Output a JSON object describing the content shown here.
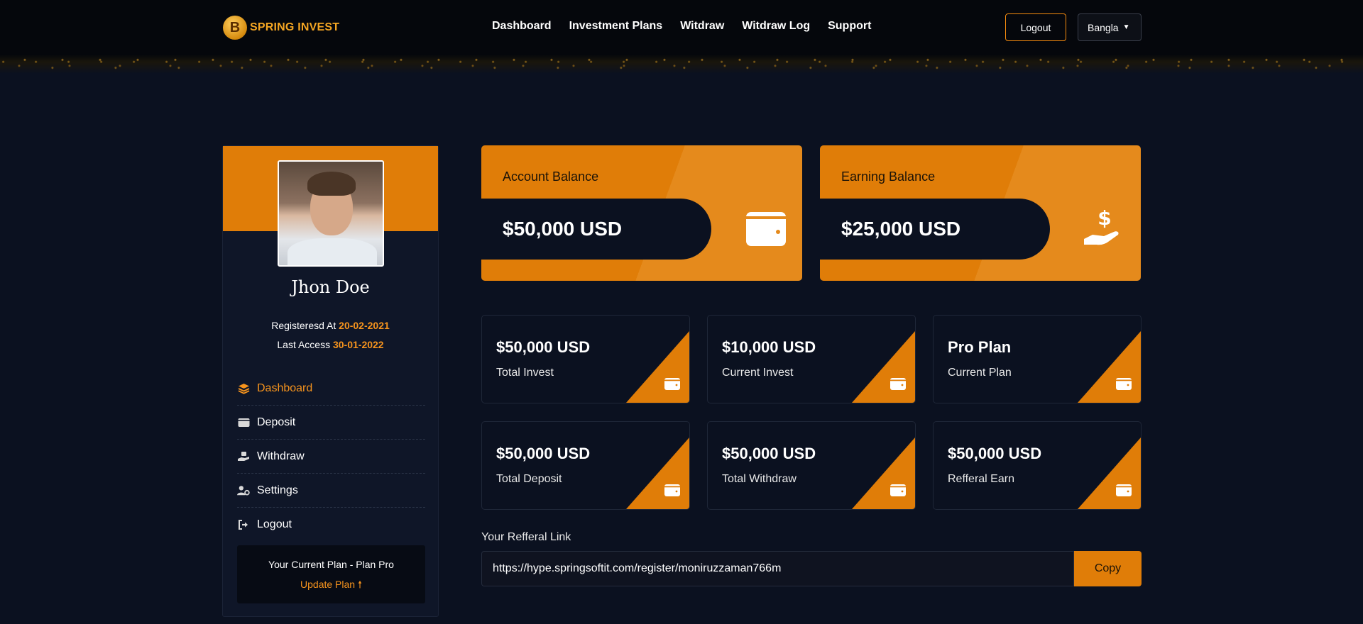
{
  "brand": {
    "name": "SPRING INVEST",
    "coin_glyph": "B"
  },
  "nav": [
    "Dashboard",
    "Investment Plans",
    "Witdraw",
    "Witdraw Log",
    "Support"
  ],
  "header": {
    "logout_label": "Logout",
    "language": "Bangla"
  },
  "profile": {
    "name": "Jhon Doe",
    "registered_label": "Registeresd At",
    "registered_date": "20-02-2021",
    "last_access_label": "Last Access",
    "last_access_date": "30-01-2022"
  },
  "menu": [
    {
      "label": "Dashboard",
      "icon": "layers-icon",
      "active": true
    },
    {
      "label": "Deposit",
      "icon": "wallet-icon",
      "active": false
    },
    {
      "label": "Withdraw",
      "icon": "hand-money-icon",
      "active": false
    },
    {
      "label": "Settings",
      "icon": "user-gear-icon",
      "active": false
    },
    {
      "label": "Logout",
      "icon": "sign-out-icon",
      "active": false
    }
  ],
  "plan": {
    "current_text": "Your Current Plan - Plan Pro",
    "update_label": "Update Plan",
    "update_icon": "arrow-up-icon"
  },
  "balances": [
    {
      "label": "Account Balance",
      "value": "$50,000 USD",
      "icon": "wallet-icon"
    },
    {
      "label": "Earning Balance",
      "value": "$25,000 USD",
      "icon": "hand-dollar-icon"
    }
  ],
  "stats": [
    {
      "value": "$50,000 USD",
      "caption": "Total Invest"
    },
    {
      "value": "$10,000 USD",
      "caption": "Current Invest"
    },
    {
      "value": "Pro Plan",
      "caption": "Current Plan"
    },
    {
      "value": "$50,000 USD",
      "caption": "Total Deposit"
    },
    {
      "value": "$50,000 USD",
      "caption": "Total Withdraw"
    },
    {
      "value": "$50,000 USD",
      "caption": "Refferal Earn"
    }
  ],
  "referral": {
    "label": "Your Refferal Link",
    "url": "https://hype.springsoftit.com/register/moniruzzaman766m",
    "copy_label": "Copy"
  },
  "colors": {
    "accent": "#e07d08",
    "highlight": "#f7941d",
    "background": "#0b1120",
    "card": "#0f1628"
  }
}
